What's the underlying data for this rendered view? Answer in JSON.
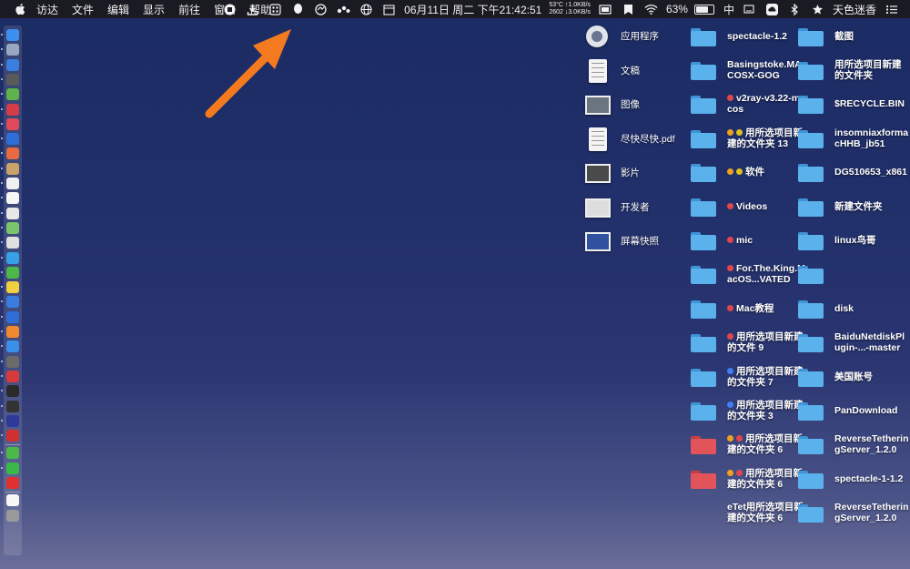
{
  "menubar": {
    "items": [
      "访达",
      "文件",
      "编辑",
      "显示",
      "前往",
      "窗口",
      "帮助"
    ],
    "netspeed_line1": "53°C ↑1.0KB/s",
    "netspeed_line2": "2602 ↓3.0KB/s",
    "datetime": "06月11日 周二 下午21:42:51",
    "battery": "63%",
    "input_method": "中",
    "username": "天色迷香",
    "tray_icons": [
      "record-stop-icon",
      "download-icon",
      "app-grid-icon",
      "qq-icon",
      "sync-icon",
      "dots-icon",
      "globe-icon",
      "calendar-icon",
      "window-icon",
      "bookmark-icon",
      "wifi-icon",
      "battery-icon",
      "input-icon",
      "cloud-icon",
      "bluetooth-icon",
      "star-icon",
      "list-icon"
    ]
  },
  "desktop": {
    "col1": [
      {
        "label": "应用程序",
        "icon": "applications-folder-icon"
      },
      {
        "label": "文稿",
        "icon": "documents-folder-icon"
      },
      {
        "label": "图像",
        "icon": "pictures-folder-icon"
      },
      {
        "label": "尽快尽快.pdf",
        "icon": "pdf-document-icon"
      },
      {
        "label": "影片",
        "icon": "movies-folder-icon"
      },
      {
        "label": "开发者",
        "icon": "developer-folder-icon"
      },
      {
        "label": "屏幕快照",
        "icon": "screenshot-icon"
      }
    ],
    "col2": [
      {
        "label": "spectacle-1.2",
        "tags": [],
        "folder_color": "blue"
      },
      {
        "label": "Basingstoke.MACOSX-GOG",
        "tags": [],
        "folder_color": "blue"
      },
      {
        "label": "v2ray-v3.22-macos",
        "tags": [
          "#e0474c"
        ],
        "folder_color": "blue"
      },
      {
        "label": "用所选项目新建的文件夹 13",
        "tags": [
          "#f0a020",
          "#e0c020"
        ],
        "folder_color": "blue"
      },
      {
        "label": "软件",
        "tags": [
          "#f0a020",
          "#e0c020"
        ],
        "folder_color": "blue"
      },
      {
        "label": "Videos",
        "tags": [
          "#e0474c"
        ],
        "folder_color": "blue"
      },
      {
        "label": "mic",
        "tags": [
          "#e0474c"
        ],
        "folder_color": "blue"
      },
      {
        "label": "For.The.King.MacOS...VATED",
        "tags": [
          "#e0474c"
        ],
        "folder_color": "blue"
      },
      {
        "label": "Mac教程",
        "tags": [
          "#e0474c"
        ],
        "folder_color": "blue"
      },
      {
        "label": "用所选项目新建的文件 9",
        "tags": [
          "#e0474c"
        ],
        "folder_color": "blue"
      },
      {
        "label": "用所选项目新建的文件夹 7",
        "tags": [
          "#3f7ff0"
        ],
        "folder_color": "blue"
      },
      {
        "label": "用所选项目新建的文件夹 3",
        "tags": [
          "#3f7ff0"
        ],
        "folder_color": "blue"
      },
      {
        "label": "用所选项目新建的文件夹 6",
        "tags": [
          "#f0a020",
          "#e0474c"
        ],
        "folder_color": "red"
      },
      {
        "label": "用所选项目新建的文件夹 6",
        "tags": [
          "#f0a020",
          "#e0474c"
        ],
        "folder_color": "red"
      },
      {
        "label": "eTet用所选项目新建的文件夹 6",
        "tags": [],
        "folder_color": "none"
      }
    ],
    "col3": [
      {
        "label": "截图"
      },
      {
        "label": "用所选项目新建的文件夹"
      },
      {
        "label": "$RECYCLE.BIN"
      },
      {
        "label": "insomniaxformacHHB_jb51"
      },
      {
        "label": "DG510653_x861"
      },
      {
        "label": "新建文件夹"
      },
      {
        "label": "linux鸟哥"
      },
      {
        "label": ""
      },
      {
        "label": "disk"
      },
      {
        "label": "BaiduNetdiskPlugin-...-master"
      },
      {
        "label": "美国账号"
      },
      {
        "label": "PanDownload"
      },
      {
        "label": "ReverseTetheringServer_1.2.0"
      },
      {
        "label": "spectacle-1-1.2"
      },
      {
        "label": "ReverseTetheringServer_1.2.0"
      }
    ]
  },
  "colors": {
    "folder_blue": "#5ab1ec",
    "folder_blue_tab": "#3e94d4",
    "folder_red": "#e2545a",
    "folder_red_tab": "#c43f45",
    "arrow": "#f47a20"
  }
}
